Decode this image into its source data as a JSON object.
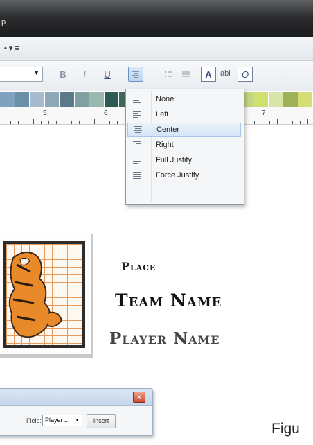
{
  "window": {
    "title_fragment": "p"
  },
  "toolbar": {
    "row1_glyphs": "• ▾ ≡"
  },
  "font_buttons": {
    "bold": "B",
    "italic": "I",
    "underline": "U"
  },
  "icons": {
    "text_frame": "A",
    "abl": "abl",
    "character": "O"
  },
  "ruler": {
    "labels": [
      "5",
      "6",
      "7"
    ]
  },
  "palette": [
    "#7fa2bf",
    "#6b8ea9",
    "#a6bcce",
    "#8ea7b6",
    "#5b7a88",
    "#7f9fa0",
    "#9ab8ad",
    "#2e5a55",
    "#41675c",
    "#6c8c7e",
    "#4f7a6a",
    "#5b8c7a",
    "#8fb497",
    "#b7c7a0",
    "#98b86a",
    "#b7d072",
    "#c3d585",
    "#cfe06e",
    "#d8e4a8",
    "#9cb158",
    "#d5de72"
  ],
  "alignment_menu": {
    "items": [
      {
        "label": "None",
        "icon": "align-none-icon"
      },
      {
        "label": "Left",
        "icon": "align-left-icon"
      },
      {
        "label": "Center",
        "icon": "align-center-icon"
      },
      {
        "label": "Right",
        "icon": "align-right-icon"
      },
      {
        "label": "Full Justify",
        "icon": "align-justify-icon"
      },
      {
        "label": "Force Justify",
        "icon": "align-force-justify-icon"
      }
    ],
    "selected": "Center"
  },
  "card": {
    "place": "Place",
    "team_name": "Team Name",
    "player_name": "Player Name"
  },
  "dialog": {
    "field_label": "Field:",
    "field_value": "Player ...",
    "insert_label": "Insert"
  },
  "caption": {
    "text": "Figu"
  }
}
